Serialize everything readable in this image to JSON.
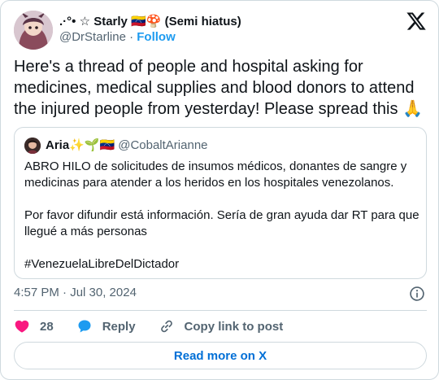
{
  "tweet": {
    "author": {
      "display_name": ".·°• ☆ Starly 🇻🇪🍄 (Semi hiatus)",
      "handle": "@DrStarline",
      "separator": "·",
      "follow_label": "Follow"
    },
    "text": "Here's a thread of people and hospital asking for medicines, medical supplies and blood donors to attend the injured people from yesterday! Please spread this 🙏",
    "quoted": {
      "display_name": "Aria✨🌱🇻🇪",
      "handle": "@CobaltArianne",
      "paragraphs": [
        "ABRO HILO de solicitudes de insumos médicos, donantes de sangre y medicinas para atender a los heridos en los hospitales venezolanos.",
        "Por favor difundir está información. Sería de gran ayuda dar RT para que llegué a más personas",
        "#VenezuelaLibreDelDictador"
      ]
    },
    "timestamp": "4:57 PM · Jul 30, 2024",
    "actions": {
      "like_count": "28",
      "reply_label": "Reply",
      "copy_link_label": "Copy link to post"
    },
    "read_more_label": "Read more on X"
  },
  "colors": {
    "accent": "#1d9bf0",
    "read_more_text": "#006fd6",
    "like": "#f91880",
    "text_primary": "#0f1419",
    "text_secondary": "#536471",
    "border": "#cfd9de"
  },
  "icons": [
    "x-logo-icon",
    "info-icon",
    "heart-icon",
    "reply-bubble-icon",
    "link-icon"
  ]
}
